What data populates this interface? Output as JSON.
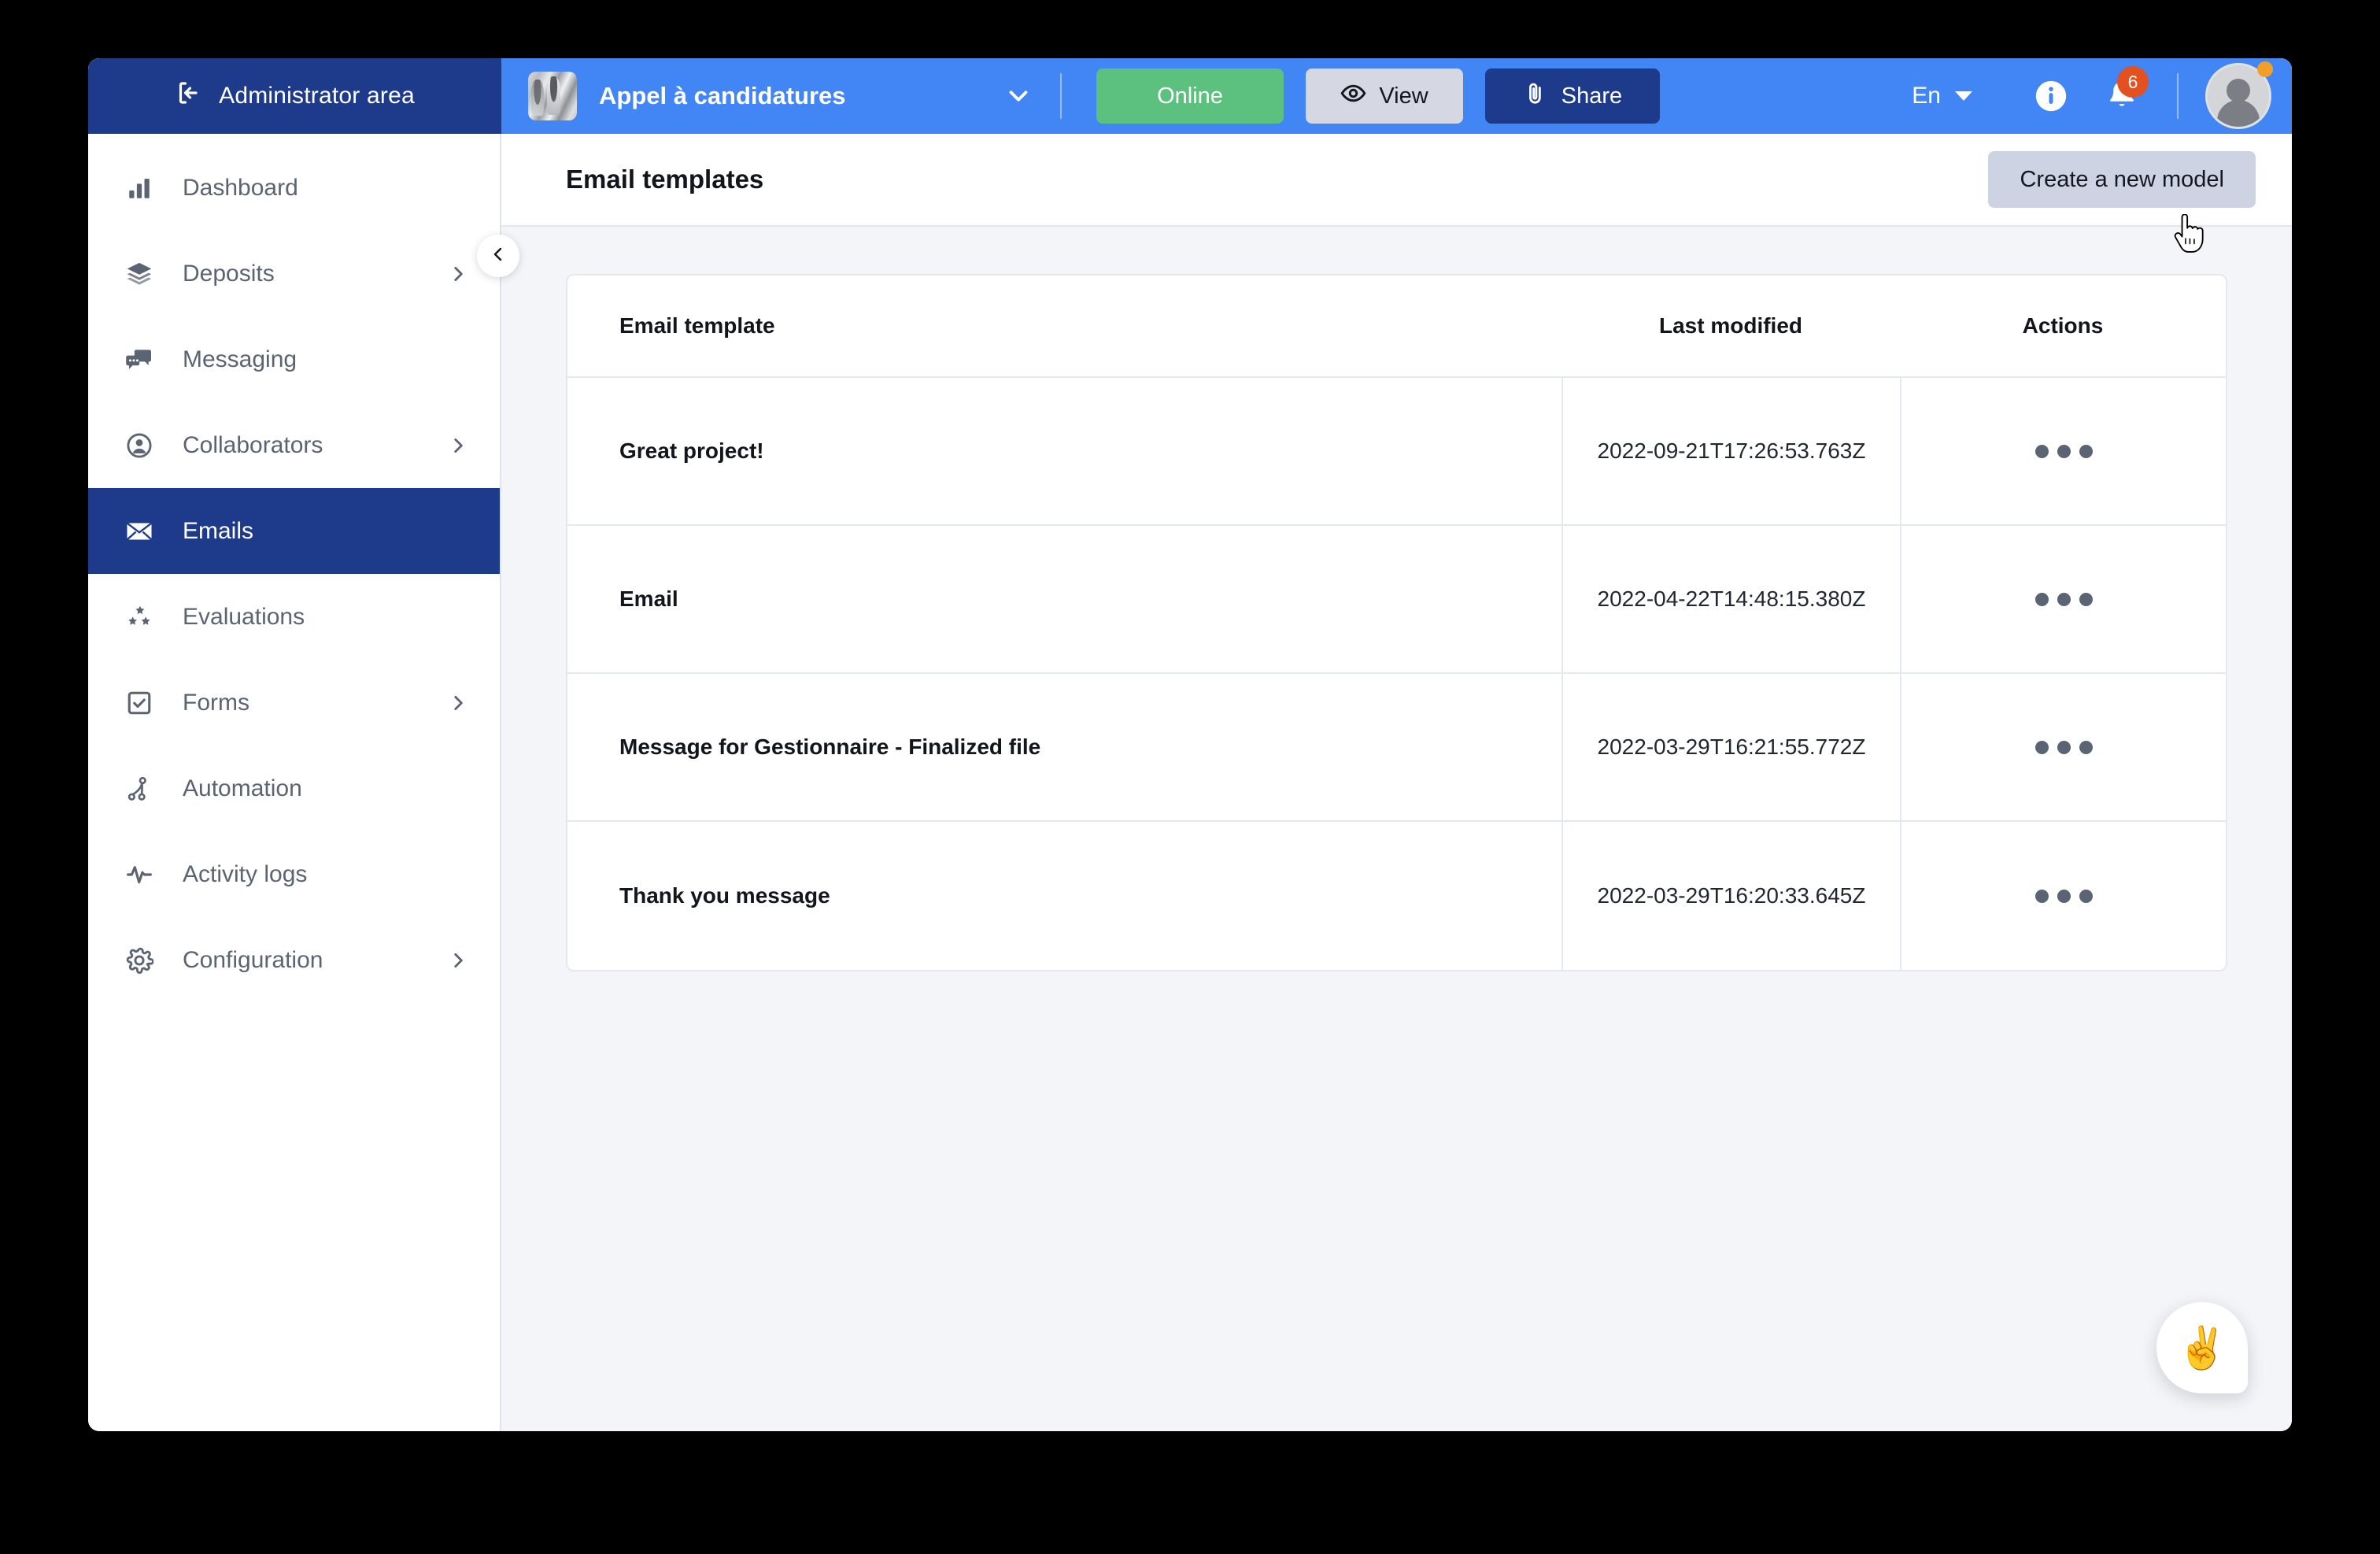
{
  "topbar": {
    "admin_area_label": "Administrator area",
    "admin_icon": "login-arrow-icon",
    "project_name": "Appel à candidatures",
    "project_thumb_icon": "project-thumbnail",
    "project_chevron_icon": "chevron-down-icon",
    "buttons": {
      "online_label": "Online",
      "view_label": "View",
      "view_icon": "eye-icon",
      "share_label": "Share",
      "share_icon": "paperclip-icon"
    },
    "language": "En",
    "info_icon": "info-icon",
    "bell_icon": "bell-icon",
    "notification_count": "6",
    "avatar_icon": "avatar",
    "colors": {
      "topbar_blue": "#4285f4",
      "admin_navy": "#1e3a8a",
      "online_green": "#5cc17f",
      "view_gray": "#d5d8e2",
      "badge_orange": "#e2511f",
      "status_dot": "#f0a027"
    }
  },
  "sidebar": {
    "collapse_icon": "chevron-left-icon",
    "items": [
      {
        "label": "Dashboard",
        "icon": "bar-chart-icon",
        "has_chevron": false,
        "active": false
      },
      {
        "label": "Deposits",
        "icon": "layers-icon",
        "has_chevron": true,
        "active": false
      },
      {
        "label": "Messaging",
        "icon": "chat-icon",
        "has_chevron": false,
        "active": false
      },
      {
        "label": "Collaborators",
        "icon": "user-circle-icon",
        "has_chevron": true,
        "active": false
      },
      {
        "label": "Emails",
        "icon": "envelope-icon",
        "has_chevron": false,
        "active": true
      },
      {
        "label": "Evaluations",
        "icon": "stars-icon",
        "has_chevron": false,
        "active": false
      },
      {
        "label": "Forms",
        "icon": "checkbox-icon",
        "has_chevron": true,
        "active": false
      },
      {
        "label": "Automation",
        "icon": "workflow-icon",
        "has_chevron": false,
        "active": false
      },
      {
        "label": "Activity logs",
        "icon": "pulse-icon",
        "has_chevron": false,
        "active": false
      },
      {
        "label": "Configuration",
        "icon": "gear-icon",
        "has_chevron": true,
        "active": false
      }
    ]
  },
  "page": {
    "title": "Email templates",
    "create_button_label": "Create a new model"
  },
  "table": {
    "headers": {
      "name": "Email template",
      "date": "Last modified",
      "actions": "Actions"
    },
    "rows": [
      {
        "name": "Great project!",
        "date": "2022-09-21T17:26:53.763Z",
        "actions_icon": "more-options-icon"
      },
      {
        "name": "Email",
        "date": "2022-04-22T14:48:15.380Z",
        "actions_icon": "more-options-icon"
      },
      {
        "name": "Message for Gestionnaire - Finalized file",
        "date": "2022-03-29T16:21:55.772Z",
        "actions_icon": "more-options-icon"
      },
      {
        "name": "Thank you message",
        "date": "2022-03-29T16:20:33.645Z",
        "actions_icon": "more-options-icon"
      }
    ]
  },
  "chat_widget": {
    "emoji": "✌️",
    "icon": "victory-hand-icon"
  }
}
